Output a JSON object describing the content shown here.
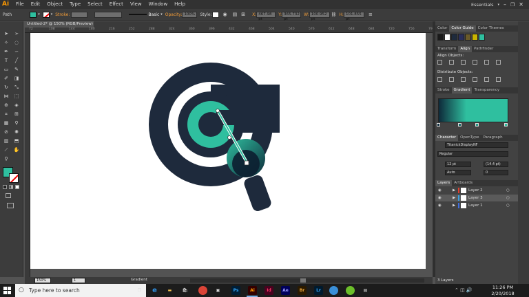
{
  "app": {
    "logo": "Ai",
    "menu": [
      "File",
      "Edit",
      "Object",
      "Type",
      "Select",
      "Effect",
      "View",
      "Window",
      "Help"
    ],
    "workspace": "Essentials"
  },
  "control_bar": {
    "selection_type": "Path",
    "stroke_label": "Stroke:",
    "stroke_profile": "Basic",
    "opacity_label": "Opacity:",
    "opacity_value": "100%",
    "style_label": "Style:",
    "x_label": "X:",
    "x_value": "467.98 pt",
    "y_label": "Y:",
    "y_value": "365.732 pt",
    "w_label": "W:",
    "w_value": "100.952 pt",
    "h_label": "H:",
    "h_value": "101.855 pt",
    "fill_color": "#2fbf9f"
  },
  "document": {
    "tab_title": "Untitled-2* @ 150% (RGB/Preview)",
    "ruler_ticks": [
      "72",
      "108",
      "144",
      "180",
      "216",
      "252",
      "288",
      "324",
      "360",
      "396",
      "432",
      "468",
      "504",
      "540",
      "576",
      "612",
      "648",
      "684",
      "720",
      "756",
      "792"
    ]
  },
  "artwork": {
    "dark_color": "#1e2a3c",
    "teal_color": "#2fbf9f",
    "white": "#ffffff"
  },
  "panels": {
    "color_tabs": [
      "Color",
      "Color Guide",
      "Color Themes"
    ],
    "align_tabs": [
      "Transform",
      "Align",
      "Pathfinder"
    ],
    "align_objects_label": "Align Objects:",
    "distribute_label": "Distribute Objects:",
    "gradient_tabs": [
      "Stroke",
      "Gradient",
      "Transparency"
    ],
    "gradient_start": "#0e2a3a",
    "gradient_end": "#2fbf9f",
    "character_tabs": [
      "Character",
      "OpenType",
      "Paragraph"
    ],
    "font_name": "TitanickDisplayNF",
    "font_style": "Regular",
    "font_size": "12 pt",
    "leading": "(14.4 pt)",
    "kerning": "Auto",
    "tracking": "0",
    "layers_tabs": [
      "Layers",
      "Artboards"
    ],
    "layers": [
      {
        "name": "Layer 2",
        "color": "#e0402f"
      },
      {
        "name": "Layer 3",
        "color": "#3aa0e0"
      },
      {
        "name": "Layer 1",
        "color": "#3f6ee0"
      }
    ],
    "layers_count": "3 Layers",
    "swatch_colors": [
      "#1a1a1a",
      "#ffffff",
      "#1e2a3c",
      "#2a2e5a",
      "#6a5a2a",
      "#c8b400",
      "#2fbf9f"
    ]
  },
  "status_bar": {
    "zoom": "150%",
    "page": "1",
    "tool_name": "Gradient"
  },
  "taskbar": {
    "search_placeholder": "Type here to search",
    "apps": [
      "Ps",
      "Ai",
      "Id",
      "Ae",
      "Br",
      "Lr"
    ],
    "time": "11:26 PM",
    "date": "2/20/2018"
  }
}
